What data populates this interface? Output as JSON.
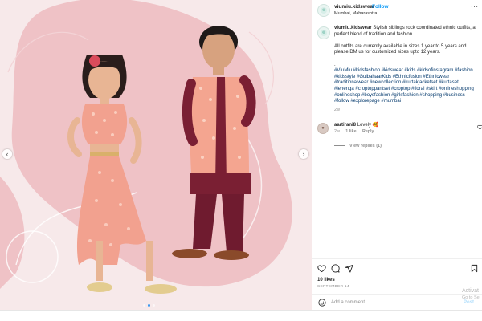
{
  "post": {
    "username": "viumiu.kidswear",
    "follow_label": "Follow",
    "separator": "•",
    "location": "Mumbai, Maharashtra",
    "more_label": "···",
    "caption_intro": "Stylish siblings rock coordinated ethnic outfits, a perfect blend of tradition and fashion.",
    "caption_sizes": "All outfits are currently available in sizes 1 year to 5 years and please DM us for customized sizes upto 12 years.",
    "caption_dot": ".",
    "hashtags": "#VIuMiu #kidsfashion #kidswear #kids #kidsofinstagram #fashion #kidsstyle #GulbahaarKids #Ethnicfusion #Ethnicwear #traditionalwear #newcollection #kurtakjacketset #kurtaset #lehenga #croptoppantset #croptop #floral #skirt #onlineshopping #onlineshop #boysfashion #girlsfashion #shopping #business #follow #explorepage #mumbai",
    "age": "2w",
    "likes": "10 likes",
    "date": "SEPTEMBER 14"
  },
  "comment": {
    "username": "aartirani8",
    "text": "Lovely 🥰",
    "age": "2w",
    "likes": "1 like",
    "reply_label": "Reply",
    "view_replies": "View replies (1)"
  },
  "add_comment": {
    "placeholder": "Add a comment...",
    "post_label": "Post"
  },
  "carousel": {
    "left_arrow": "‹",
    "right_arrow": "›",
    "slide_count": 3,
    "active_index": 1
  },
  "watermark": {
    "title": "Activat",
    "subtitle": "Go to Se"
  },
  "colors": {
    "accent": "#0095f6",
    "background_pink": "#f7e9ea",
    "shape_pink": "#efc2c6",
    "tag_blue": "#00376b"
  }
}
